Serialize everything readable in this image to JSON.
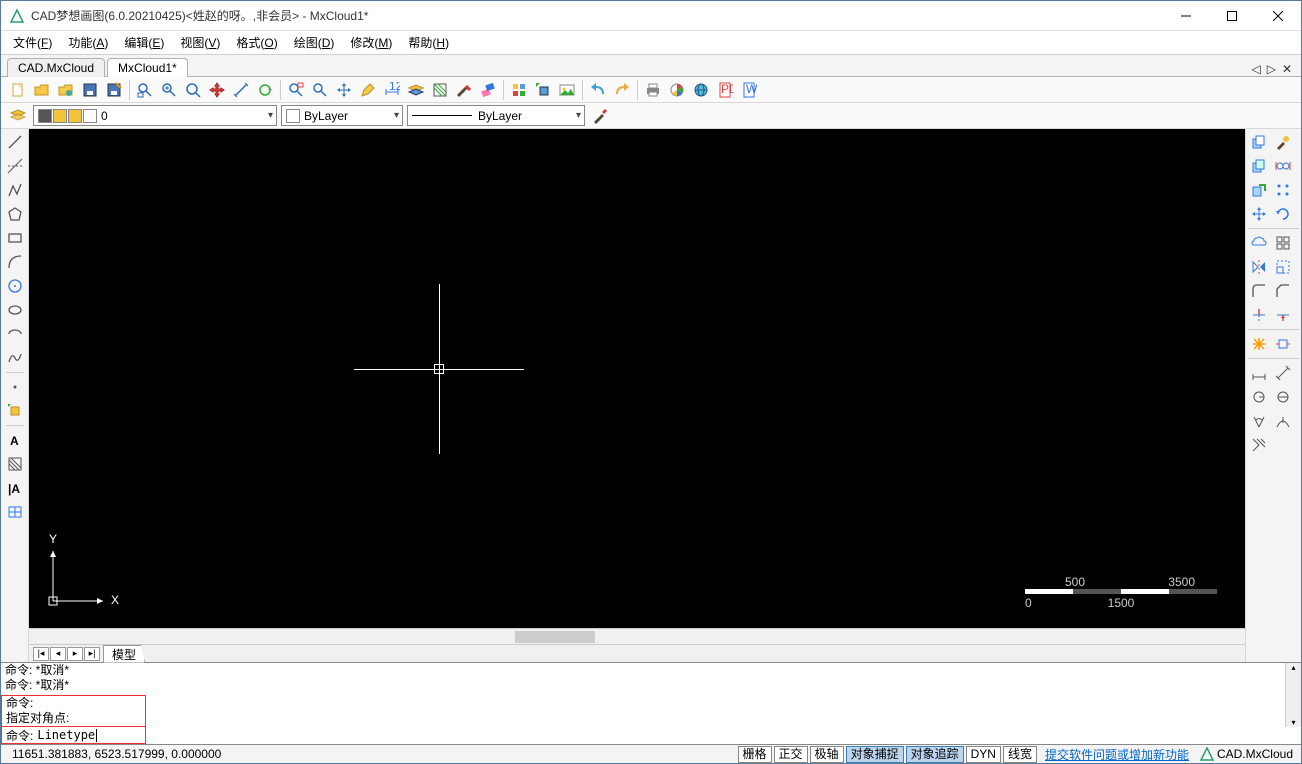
{
  "window": {
    "title": "CAD梦想画图(6.0.20210425)<姓赵的呀。,非会员> - MxCloud1*"
  },
  "menu": {
    "items": [
      {
        "label": "文件",
        "accel": "F"
      },
      {
        "label": "功能",
        "accel": "A"
      },
      {
        "label": "编辑",
        "accel": "E"
      },
      {
        "label": "视图",
        "accel": "V"
      },
      {
        "label": "格式",
        "accel": "O"
      },
      {
        "label": "绘图",
        "accel": "D"
      },
      {
        "label": "修改",
        "accel": "M"
      },
      {
        "label": "帮助",
        "accel": "H"
      }
    ]
  },
  "tabs": {
    "items": [
      {
        "label": "CAD.MxCloud",
        "active": false
      },
      {
        "label": "MxCloud1*",
        "active": true
      }
    ]
  },
  "toolbar_std": [
    "new-doc",
    "open",
    "import",
    "save",
    "save-as",
    "sep",
    "zoom-window",
    "zoom-in",
    "zoom-out",
    "pan",
    "distance",
    "regen",
    "sep",
    "zoom-extents",
    "zoom-realtime",
    "move-view",
    "pencil",
    "dimension",
    "layers",
    "hatch",
    "match",
    "erase",
    "sep",
    "block",
    "insert-block",
    "image",
    "sep",
    "undo",
    "redo",
    "sep",
    "print",
    "color-wheel",
    "globe",
    "pdf",
    "word"
  ],
  "properties": {
    "layer_value": "0",
    "color_label": "ByLayer",
    "linetype_label": "ByLayer"
  },
  "left_tools": [
    "line",
    "xline",
    "pline",
    "polygon",
    "rectangle",
    "arc",
    "circle",
    "ellipse",
    "ellipse-arc",
    "spline",
    "sep",
    "point",
    "insert",
    "sep",
    "text-single",
    "hatch-tool",
    "text-multi",
    "table"
  ],
  "right_tools": [
    "copy",
    "paint",
    "copy2",
    "mirror-r",
    "copy3",
    "array",
    "move",
    "rotate",
    "sep2",
    "cloud",
    "grid4",
    "mirror",
    "scale",
    "fillet",
    "chamfer",
    "trim",
    "extend",
    "sep2",
    "explode",
    "stretch",
    "sep2",
    "dim1",
    "dim2",
    "dim3",
    "dim4",
    "dim5",
    "arc-dim",
    "hatch-r"
  ],
  "canvas": {
    "ucs": {
      "x_label": "X",
      "y_label": "Y"
    },
    "scale": {
      "t1": "500",
      "t2": "3500",
      "b1": "0",
      "b2": "1500"
    }
  },
  "view_tabs": {
    "model": "模型"
  },
  "command": {
    "hist1": "命令:  *取消*",
    "hist2": "命令:  *取消*",
    "boxed1": "命令:",
    "boxed2": "指定对角点:",
    "prompt": "命令:",
    "input": "Linetype"
  },
  "status": {
    "coords": "11651.381883,  6523.517999,  0.000000",
    "btns": [
      {
        "label": "栅格",
        "pressed": false
      },
      {
        "label": "正交",
        "pressed": false
      },
      {
        "label": "极轴",
        "pressed": false
      },
      {
        "label": "对象捕捉",
        "pressed": true
      },
      {
        "label": "对象追踪",
        "pressed": true
      },
      {
        "label": "DYN",
        "pressed": false
      },
      {
        "label": "线宽",
        "pressed": false
      }
    ],
    "feedback_link": "提交软件问题或增加新功能",
    "brand": "CAD.MxCloud"
  }
}
